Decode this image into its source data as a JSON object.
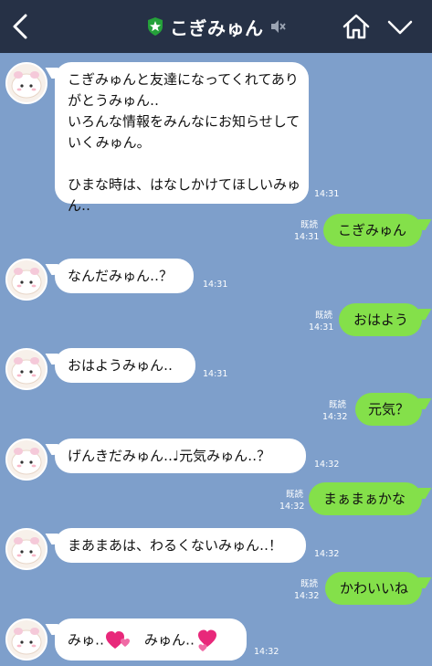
{
  "header": {
    "title": "こぎみゅん",
    "colors": {
      "bg": "#263146",
      "verified": "#25a13a"
    },
    "icons": [
      "back-arrow-icon",
      "verified-star-icon",
      "muted-speaker-icon",
      "home-icon",
      "chevron-down-icon"
    ]
  },
  "colors": {
    "chat_bg": "#7e9fcb",
    "incoming": "#ffffff",
    "outgoing": "#84e04a"
  },
  "messages": [
    {
      "side": "in",
      "text": "こぎみゅんと友達になってくれてありがとうみゅん‥\nいろんな情報をみんなにお知らせしていくみゅん。\n\nひまな時は、はなしかけてほしいみゅん‥",
      "time": "14:31"
    },
    {
      "side": "out",
      "text": "こぎみゅん",
      "read": "既読",
      "time": "14:31"
    },
    {
      "side": "in",
      "text": "なんだみゅん‥？",
      "time": "14:31"
    },
    {
      "side": "out",
      "text": "おはよう",
      "read": "既読",
      "time": "14:31"
    },
    {
      "side": "in",
      "text": "おはようみゅん‥",
      "time": "14:31"
    },
    {
      "side": "out",
      "text": "元気？",
      "read": "既読",
      "time": "14:32"
    },
    {
      "side": "in",
      "text": "げんきだみゅん‥♩元気みゅん‥？",
      "time": "14:32"
    },
    {
      "side": "out",
      "text": "まぁまぁかな",
      "read": "既読",
      "time": "14:32"
    },
    {
      "side": "in",
      "text": "まあまあは、わるくないみゅん‥！",
      "time": "14:32"
    },
    {
      "side": "out",
      "text": "かわいいね",
      "read": "既読",
      "time": "14:32"
    },
    {
      "side": "in",
      "text_a": "みゅ‥",
      "text_b": "みゅん‥",
      "time": "14:32",
      "emoji": [
        "heart-emoji",
        "heart-emoji"
      ]
    }
  ]
}
